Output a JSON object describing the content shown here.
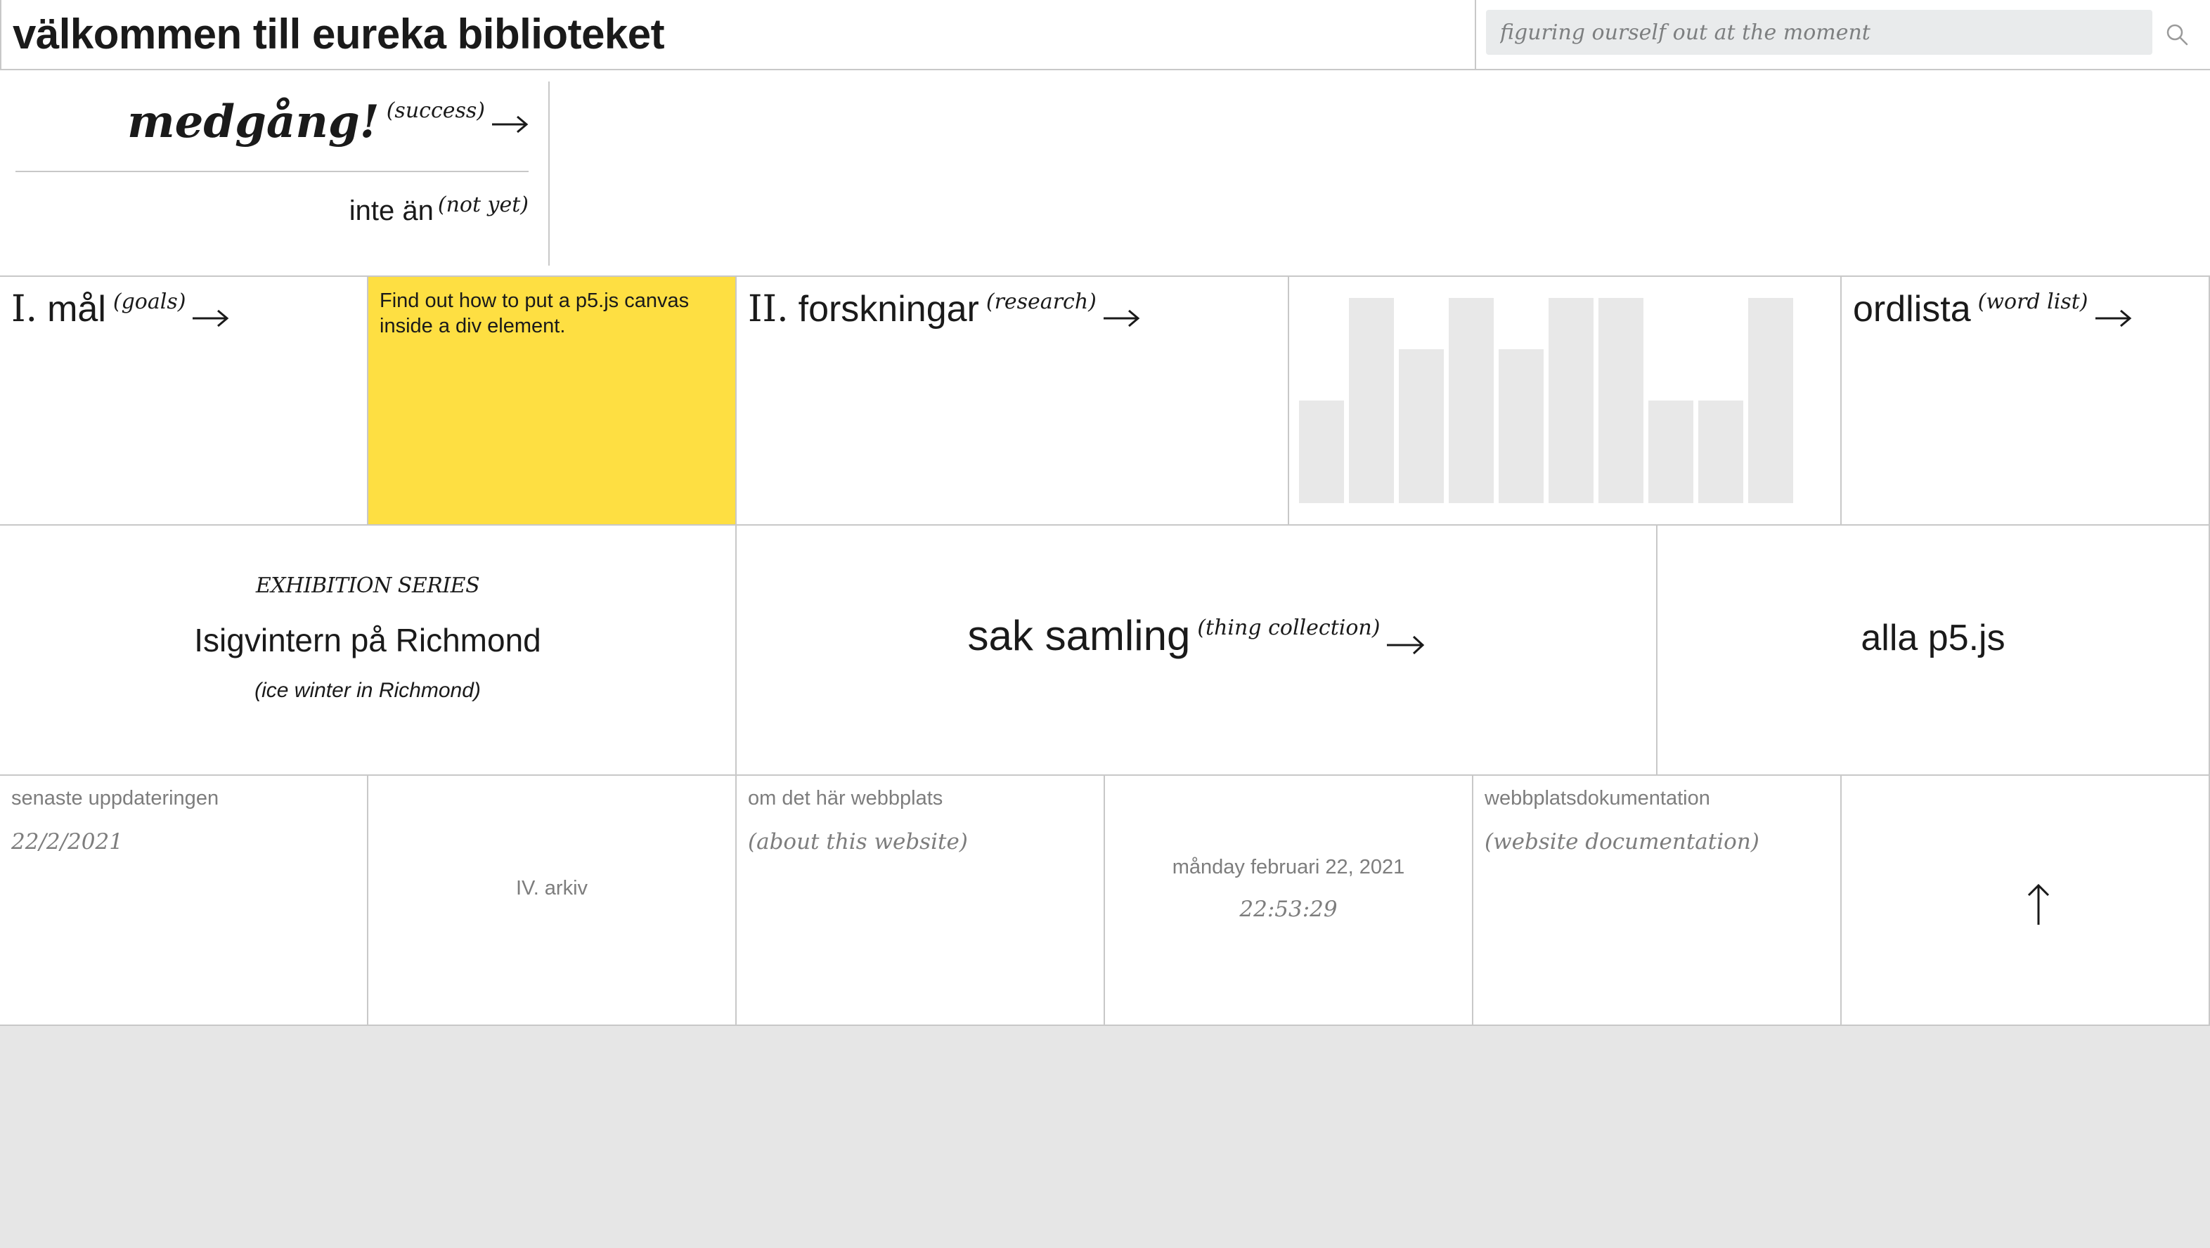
{
  "header": {
    "title": "välkommen till eureka biblioteket",
    "search_placeholder": "figuring ourself out at the moment"
  },
  "status": {
    "success_label": "medgång!",
    "success_gloss": "(success)",
    "not_yet_label": "inte än",
    "not_yet_gloss": "(not yet)"
  },
  "goals": {
    "number": "I.",
    "label": "mål",
    "gloss": "(goals)",
    "note": "Find out how to put a p5.js canvas inside a div element.",
    "note_color": "#fedf42"
  },
  "research": {
    "number": "II.",
    "label": "forskningar",
    "gloss": "(research)"
  },
  "chart_data": {
    "type": "bar",
    "values": [
      2,
      4,
      3,
      4,
      3,
      4,
      4,
      2,
      2,
      4
    ],
    "ylim": [
      0,
      4
    ],
    "color": "#e8e8e8"
  },
  "wordlist": {
    "label": "ordlista",
    "gloss": "(word list)"
  },
  "exhibition": {
    "series": "EXHIBITION SERIES",
    "title": "Isigvintern på Richmond",
    "gloss": "(ice winter in Richmond)"
  },
  "collection": {
    "label": "sak samling",
    "gloss": "(thing collection)"
  },
  "p5": {
    "label": "alla p5.js"
  },
  "footer": {
    "last_update_label": "senaste uppdateringen",
    "last_update_date": "22/2/2021",
    "archive_label": "IV. arkiv",
    "about_label": "om det här webbplats",
    "about_gloss": "(about this website)",
    "clock_date": "månday februari 22, 2021",
    "clock_time": "22:53:29",
    "docs_label": "webbplatsdokumentation",
    "docs_gloss": "(website documentation)"
  },
  "icons": {
    "search": "search-icon",
    "arrow_right": "arrow-right-icon",
    "arrow_up": "arrow-up-icon"
  }
}
